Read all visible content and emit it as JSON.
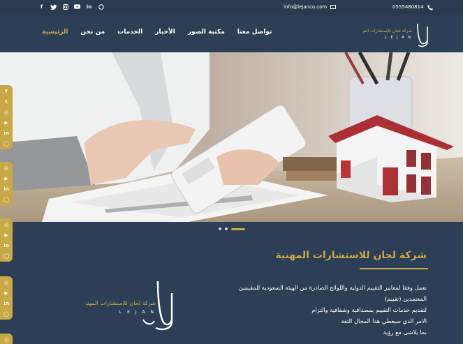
{
  "topbar": {
    "socials": [
      "facebook-icon",
      "twitter-icon",
      "instagram-icon",
      "youtube-icon",
      "linkedin-icon",
      "whatsapp-icon"
    ],
    "email": "info@lejanco.com",
    "phone": "0555480814"
  },
  "nav": {
    "items": [
      "الرئيسية",
      "من نحن",
      "الخدمات",
      "الأخبار",
      "مكتبة الصور",
      "تواصل معنا"
    ],
    "active_index": 0
  },
  "logo": {
    "arabic_name": "شركة لجان للإستشارات المهنية",
    "latin": "L E J A N",
    "mark": "لجان"
  },
  "slider": {
    "dots": 3,
    "active": 2
  },
  "about": {
    "title": "شركة لجان للاستشارات المهنية",
    "lines": [
      "نعمل وفقا لمعايير التقييم الدولية واللوائح الصادرة من الهيئة السعودية للمقيمين",
      "المعتمدين (تقييم)",
      "لتقديم خدمات التقييم بمصداقية وشفافية والتزام",
      "الامر الذي سيعطي هذا المجال الثقة",
      "بما يلاشى مع رؤية"
    ]
  },
  "colors": {
    "accent": "#c9a846",
    "background": "#2d3f56",
    "topbar": "#2a3b51"
  }
}
